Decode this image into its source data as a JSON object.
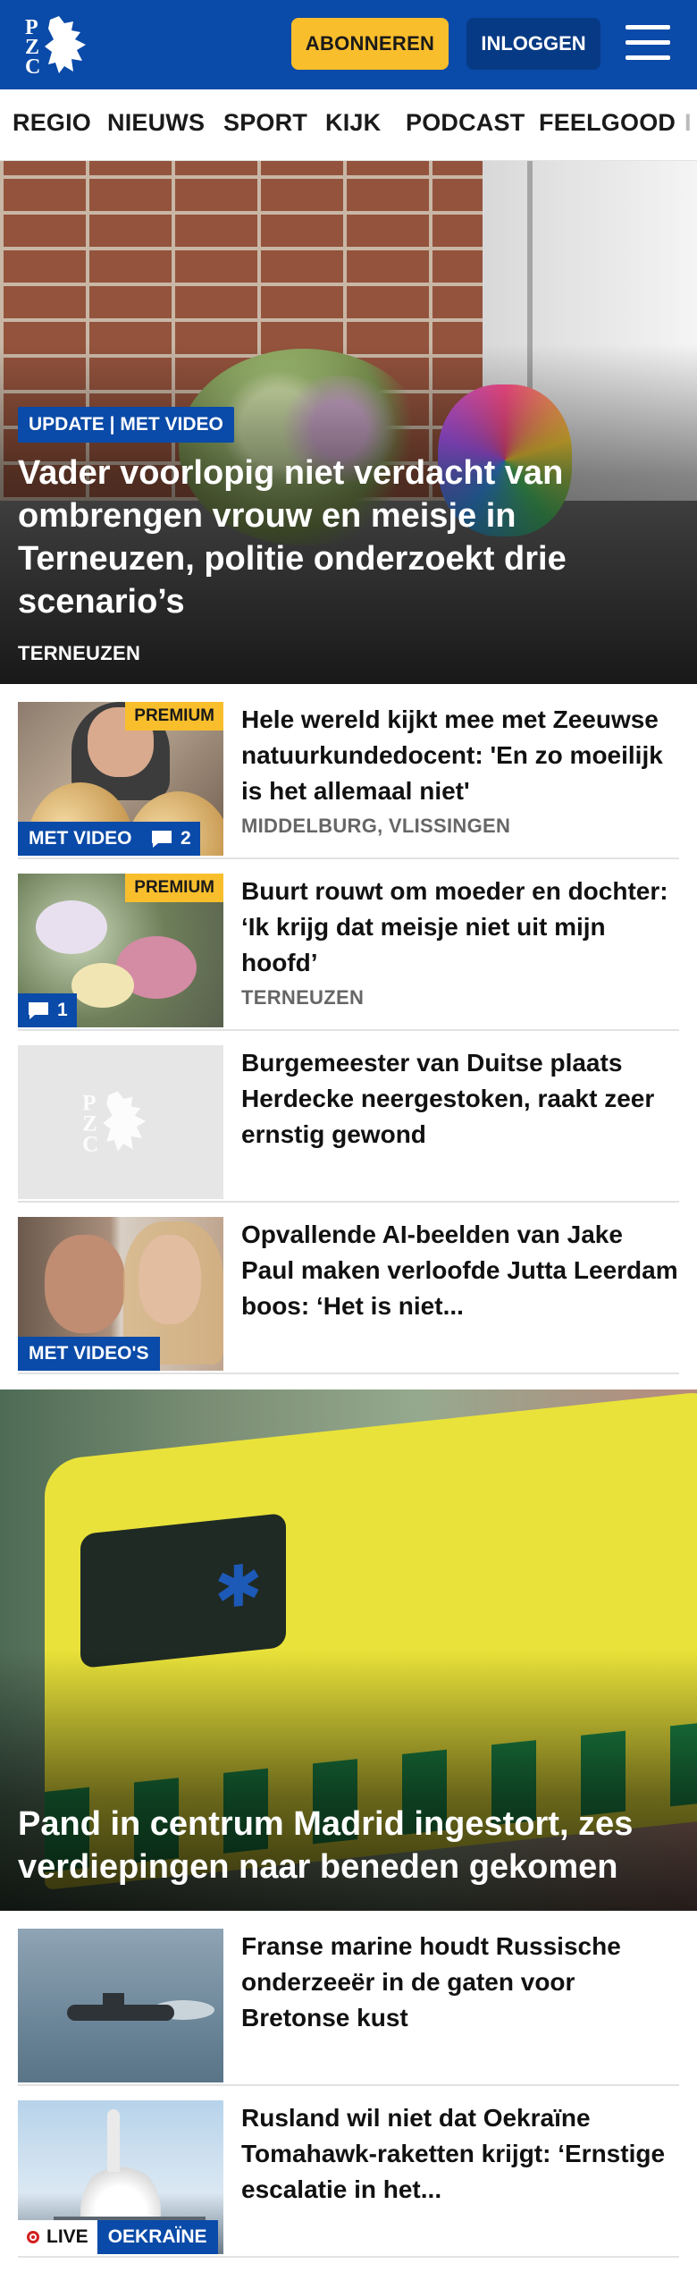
{
  "header": {
    "logo_text": "PZC",
    "subscribe_label": "ABONNEREN",
    "login_label": "INLOGGEN",
    "menu_icon": "hamburger-menu-icon",
    "background_color": "#0a4aa8",
    "subscribe_color": "#f9be2c"
  },
  "nav": {
    "items": [
      "REGIO",
      "NIEUWS",
      "SPORT",
      "KIJK",
      "PODCAST",
      "FEELGOOD",
      "I"
    ]
  },
  "hero": {
    "badge": "UPDATE | MET VIDEO",
    "title": "Vader voorlopig niet verdacht van ombrengen vrouw en meisje in Terneuzen, politie onderzoekt drie scenario’s",
    "location": "TERNEUZEN"
  },
  "articles": [
    {
      "title": "Hele wereld kijkt mee met Zeeuwse natuurkundedocent: 'En zo moeilijk is het allemaal niet'",
      "location": "MIDDELBURG, VLISSINGEN",
      "premium": "PREMIUM",
      "video_tag": "MET VIDEO",
      "comments": "2"
    },
    {
      "title": "Buurt rouwt om moeder en dochter: ‘Ik krijg dat meisje niet uit mijn hoofd’",
      "location": "TERNEUZEN",
      "premium": "PREMIUM",
      "comments": "1"
    },
    {
      "title": "Burgemeester van Duitse plaats Herdecke neergestoken, raakt zeer ernstig gewond"
    },
    {
      "title": "Opvallende AI-beelden van Jake Paul maken verloofde Jutta Leerdam boos: ‘Het is niet...",
      "video_tag": "MET VIDEO'S"
    }
  ],
  "feature": {
    "title": "Pand in centrum Madrid ingestort, zes verdiepingen naar beneden gekomen"
  },
  "articles2": [
    {
      "title": "Franse marine houdt Russische onderzeeër in de gaten voor Bretonse kust"
    },
    {
      "title": "Rusland wil niet dat Oekraïne Tomahawk-raketten krijgt: ‘Ernstige escalatie in het...",
      "live_label": "LIVE",
      "topic_tag": "OEKRAÏNE"
    }
  ]
}
